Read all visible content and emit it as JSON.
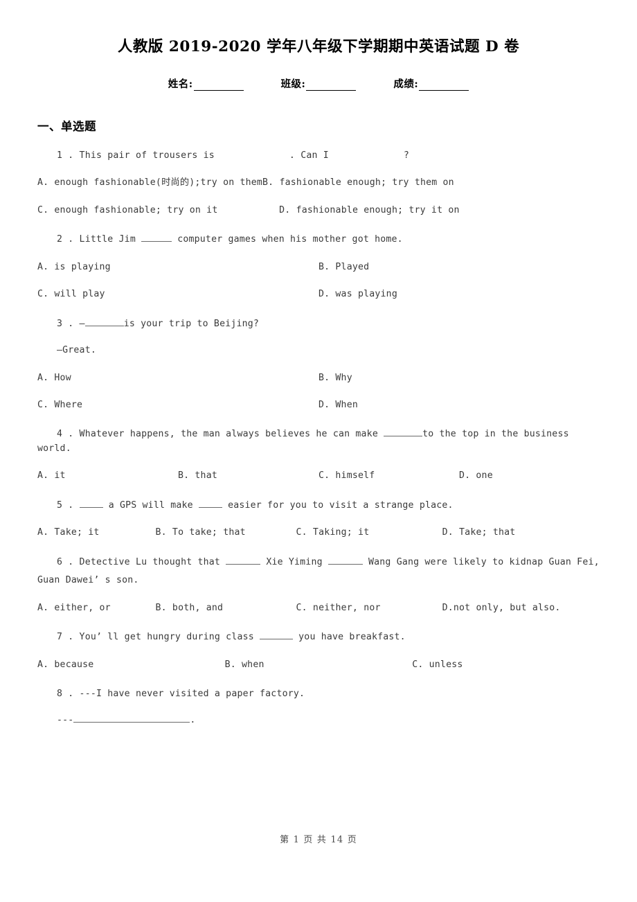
{
  "document": {
    "title": "人教版 2019-2020 学年八年级下学期期中英语试题 D 卷",
    "fields": [
      {
        "label": "姓名:",
        "value": ""
      },
      {
        "label": "班级:",
        "value": ""
      },
      {
        "label": "成绩:",
        "value": ""
      }
    ],
    "footer": "第 1 页 共 14 页"
  },
  "section": {
    "heading": "一、单选题"
  },
  "questions": [
    {
      "number": "1",
      "stem_pre": "1 . This pair of trousers is",
      "stem_mid": ". Can I",
      "stem_post": "?",
      "layout": "run",
      "options": [
        "A. enough fashionable(时尚的);try on themB. fashionable enough; try them on",
        "C. enough fashionable; try on it",
        "D. fashionable enough; try it on"
      ]
    },
    {
      "number": "2",
      "stem_pre": "2 . Little Jim ",
      "stem_post": " computer games when his mother got home.",
      "layout": "cols2",
      "options": [
        "A. is playing",
        "B. Played",
        "C. will play",
        "D. was playing"
      ]
    },
    {
      "number": "3",
      "stem_pre": "3 . —",
      "stem_post": "is your trip to Beijing?",
      "sub": "—Great.",
      "layout": "cols2",
      "options": [
        "A. How",
        "B. Why",
        "C. Where",
        "D. When"
      ]
    },
    {
      "number": "4",
      "stem_pre": "4 . Whatever happens, the man always believes he can make ",
      "stem_post": "to the top in the business world.",
      "layout": "cols4",
      "options": [
        "A. it",
        "B. that",
        "C. himself",
        "D. one"
      ]
    },
    {
      "number": "5",
      "stem_pre": "5 . ",
      "stem_mid": " a GPS will make ",
      "stem_post": " easier for you to visit a strange place.",
      "layout": "cols4b",
      "options": [
        "A. Take; it",
        "B. To take; that",
        "C. Taking; it",
        "D. Take; that"
      ]
    },
    {
      "number": "6",
      "stem_pre": "6 . Detective Lu thought that ",
      "stem_mid": " Xie Yiming ",
      "stem_post": " Wang Gang were likely to kidnap Guan Fei,",
      "stem_line2": "Guan Dawei’ s son.",
      "layout": "cols4b",
      "options": [
        "A. either, or",
        "B. both, and",
        "C. neither, nor",
        "D.not only, but also."
      ]
    },
    {
      "number": "7",
      "stem_pre": "7 . You’ ll get hungry during class ",
      "stem_post": " you have breakfast.",
      "layout": "cols3",
      "options": [
        "A. because",
        "B. when",
        "C. unless"
      ]
    },
    {
      "number": "8",
      "stem_pre": "8 . ---I have never visited a paper factory.",
      "sub_pre": "---",
      "sub_post": ".",
      "layout": "none",
      "options": []
    }
  ]
}
